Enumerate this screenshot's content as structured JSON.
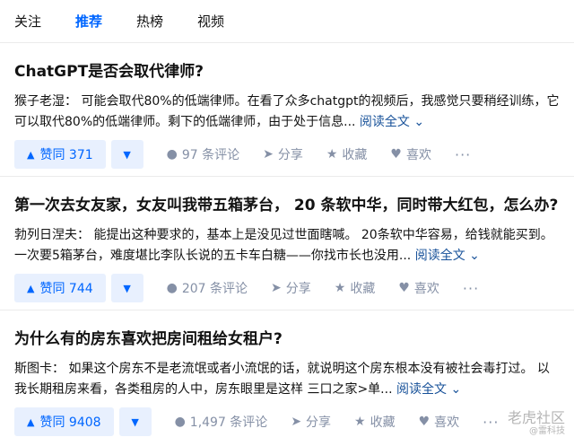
{
  "tabs": [
    {
      "label": "关注"
    },
    {
      "label": "推荐"
    },
    {
      "label": "热榜"
    },
    {
      "label": "视频"
    }
  ],
  "active_tab": "推荐",
  "cards": [
    {
      "title": "ChatGPT是否会取代律师?",
      "excerpt": "猴子老湿：  可能会取代80%的低端律师。在看了众多chatgpt的视频后，我感觉只要稍经训练，它可以取代80%的低端律师。剩下的低端律师，由于处于信息...",
      "read_more": "阅读全文",
      "vote_label": "赞同 371",
      "comments": "97 条评论",
      "share": "分享",
      "favorite": "收藏",
      "like": "喜欢",
      "more": "···"
    },
    {
      "title": "第一次去女友家，女友叫我带五箱茅台，  20 条软中华，同时带大红包，怎么办?",
      "excerpt": "勃列日涅夫：  能提出这种要求的，基本上是没见过世面瞎喊。  20条软中华容易，给钱就能买到。一次要5箱茅台，难度堪比李队长说的五卡车白糖——你找市长也没用...",
      "read_more": "阅读全文",
      "vote_label": "赞同 744",
      "comments": "207 条评论",
      "share": "分享",
      "favorite": "收藏",
      "like": "喜欢",
      "more": "···"
    },
    {
      "title": "为什么有的房东喜欢把房间租给女租户?",
      "excerpt": "斯图卡：  如果这个房东不是老流氓或者小流氓的话，就说明这个房东根本没有被社会毒打过。  以我长期租房来看，各类租房的人中，房东眼里是这样  三口之家>单...",
      "read_more": "阅读全文",
      "vote_label": "赞同 9408",
      "comments": "1,497 条评论",
      "share": "分享",
      "favorite": "收藏",
      "like": "喜欢",
      "more": "···"
    }
  ],
  "watermark": {
    "main": "老虎社区",
    "sub": "@雷科技"
  },
  "colors": {
    "accent": "#0066ff",
    "vote_bg": "#e8f0fe",
    "muted": "#8590a6",
    "link": "#175199"
  }
}
